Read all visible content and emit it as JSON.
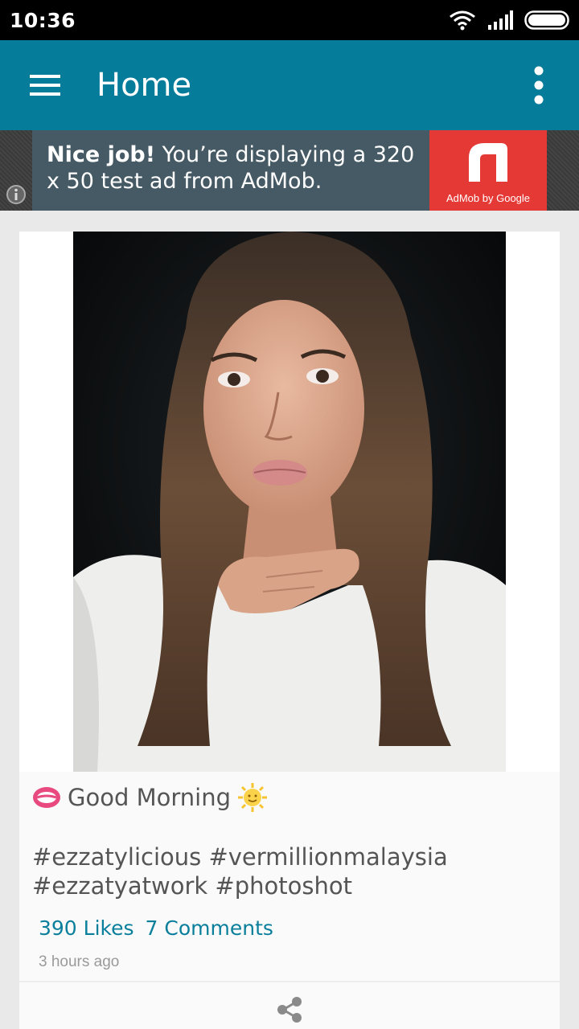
{
  "status_bar": {
    "time": "10:36"
  },
  "app_bar": {
    "title": "Home"
  },
  "ad": {
    "headline": "Nice job!",
    "text": " You’re displaying a 320 x 50 test ad from AdMob.",
    "brand": "AdMob by Google",
    "brand_color": "#e53935"
  },
  "post": {
    "caption": "Good Morning",
    "tags": "#ezzatylicious #vermillionmalaysia #ezzatyatwork #photoshot",
    "likes": "390 Likes",
    "comments": "7 Comments",
    "time_ago": "3 hours ago"
  },
  "colors": {
    "app_bar": "#057c9a",
    "link": "#0a7f9c"
  }
}
